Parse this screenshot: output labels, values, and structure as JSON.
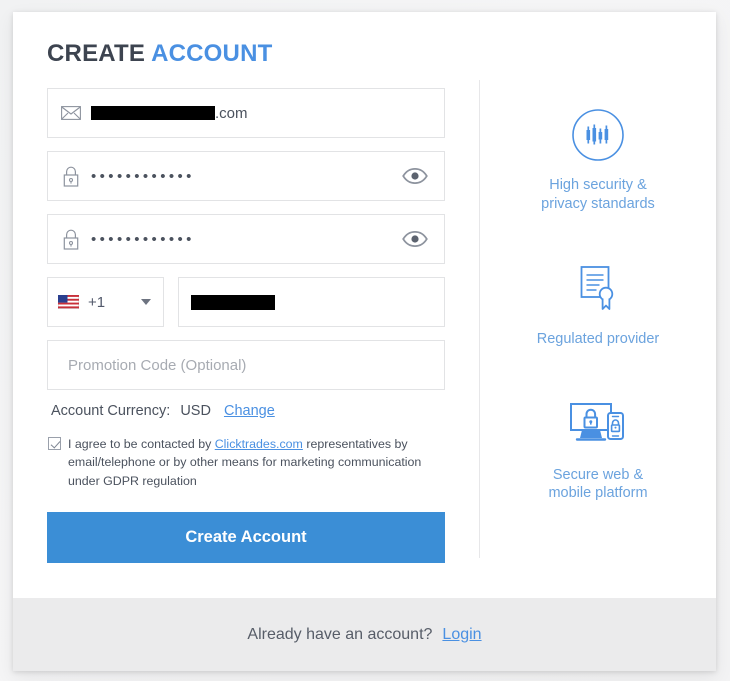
{
  "header": {
    "title_first": "CREATE",
    "title_second": "ACCOUNT"
  },
  "form": {
    "email": {
      "icon": "envelope-icon",
      "redacted": true,
      "visible_suffix": ".com"
    },
    "password": {
      "icon": "lock-icon",
      "masked_value": "••••••••••••",
      "toggle_icon": "eye-icon"
    },
    "confirm_password": {
      "icon": "lock-icon",
      "masked_value": "••••••••••••",
      "toggle_icon": "eye-icon"
    },
    "phone": {
      "country_flag": "us-flag-icon",
      "dial_code": "+1",
      "caret_icon": "chevron-down-icon",
      "number_redacted": true
    },
    "promo": {
      "placeholder": "Promotion Code (Optional)",
      "value": ""
    },
    "currency": {
      "label": "Account Currency:",
      "value": "USD",
      "change_link": "Change"
    },
    "consent": {
      "checked": true,
      "text_before": "I agree to be contacted by ",
      "link": "Clicktrades.com",
      "text_after": " representatives by email/telephone or by other means for marketing communication under GDPR regulation"
    },
    "submit_label": "Create Account"
  },
  "features": [
    {
      "icon": "candlestick-chart-circle-icon",
      "label": "High security &\nprivacy standards"
    },
    {
      "icon": "certificate-seal-icon",
      "label": "Regulated provider"
    },
    {
      "icon": "monitor-mobile-lock-icon",
      "label": "Secure web &\nmobile platform"
    }
  ],
  "footer": {
    "text": "Already have an account?",
    "link": "Login"
  },
  "colors": {
    "accent_blue": "#4a90e2",
    "button_blue": "#3b8ed6",
    "feature_blue": "#6ba3de",
    "text_dark": "#3d4450",
    "page_bg": "#f4f4f5",
    "footer_bg": "#ebebec"
  }
}
